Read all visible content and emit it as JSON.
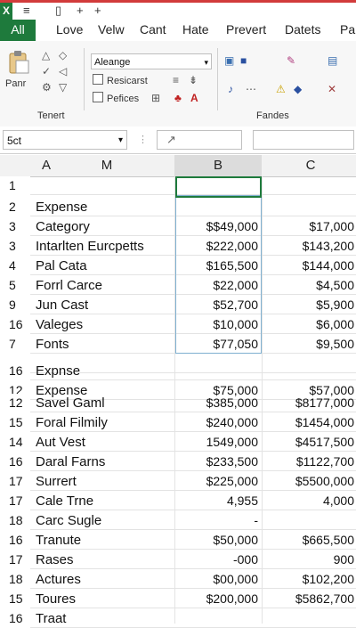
{
  "quick_access": {
    "logo": "X",
    "icon1": "≡",
    "icon2": "▯",
    "icon3": "+",
    "icon4": "+"
  },
  "tabs": [
    "All",
    "Love",
    "Velw",
    "Cant",
    "Hate",
    "Prevert",
    "Datets",
    "Pa"
  ],
  "ribbon": {
    "paste_label": "Panr",
    "clipboard_group": "Tenert",
    "font_name": "Aleange",
    "check1": "Resicarst",
    "check2": "Pefices",
    "styles_group": "Fandes"
  },
  "formula_bar": {
    "name_box": "5ct",
    "fx_label": "↗"
  },
  "columns": [
    "A",
    "M",
    "B",
    "C"
  ],
  "rows": [
    {
      "num": "1",
      "a": "",
      "b": "",
      "c": ""
    },
    {
      "num": "2",
      "a": "Expense",
      "b": "",
      "c": ""
    },
    {
      "num": "3",
      "a": "Category",
      "b": "$$49,000",
      "c": "$17,000"
    },
    {
      "num": "3",
      "a": "Intarlten Eurcpetts",
      "b": "$222,000",
      "c": "$143,200"
    },
    {
      "num": "4",
      "a": "Pal Cata",
      "b": "$165,500",
      "c": "$144,000"
    },
    {
      "num": "5",
      "a": "Forrl Carce",
      "b": "$22,000",
      "c": "$4,500"
    },
    {
      "num": "9",
      "a": "Jun Cast",
      "b": "$52,700",
      "c": "$5,900"
    },
    {
      "num": "16",
      "a": "Valeges",
      "b": "$10,000",
      "c": "$6,000"
    },
    {
      "num": "7",
      "a": "Fonts",
      "b": "$77,050",
      "c": "$9,500"
    },
    {
      "num": "",
      "a": "",
      "b": "",
      "c": ""
    },
    {
      "num": "16",
      "a": "Expnse",
      "b": "",
      "c": ""
    },
    {
      "num": "12",
      "a": "Expense",
      "b": "$75,000",
      "c": "$57,000"
    },
    {
      "num": "12",
      "a": "Savel Gaml",
      "b": "$385,000",
      "c": "$8177,000"
    },
    {
      "num": "15",
      "a": "Foral Filmily",
      "b": "$240,000",
      "c": "$1454,000"
    },
    {
      "num": "14",
      "a": "Aut Vest",
      "b": "1549,000",
      "c": "$4517,500"
    },
    {
      "num": "16",
      "a": "Daral Farns",
      "b": "$233,500",
      "c": "$1122,700"
    },
    {
      "num": "17",
      "a": "Surrert",
      "b": "$225,000",
      "c": "$5500,000"
    },
    {
      "num": "17",
      "a": "Cale Trne",
      "b": "4,955",
      "c": "4,000"
    },
    {
      "num": "18",
      "a": "Carc Sugle",
      "b": "-",
      "c": ""
    },
    {
      "num": "16",
      "a": "Tranute",
      "b": "$50,000",
      "c": "$665,500"
    },
    {
      "num": "17",
      "a": "Rases",
      "b": "-000",
      "c": "900"
    },
    {
      "num": "18",
      "a": "Actures",
      "b": "$00,000",
      "c": "$102,200"
    },
    {
      "num": "15",
      "a": "Toures",
      "b": "$200,000",
      "c": "$5862,700"
    },
    {
      "num": "16",
      "a": "Traat",
      "b": "",
      "c": ""
    }
  ]
}
